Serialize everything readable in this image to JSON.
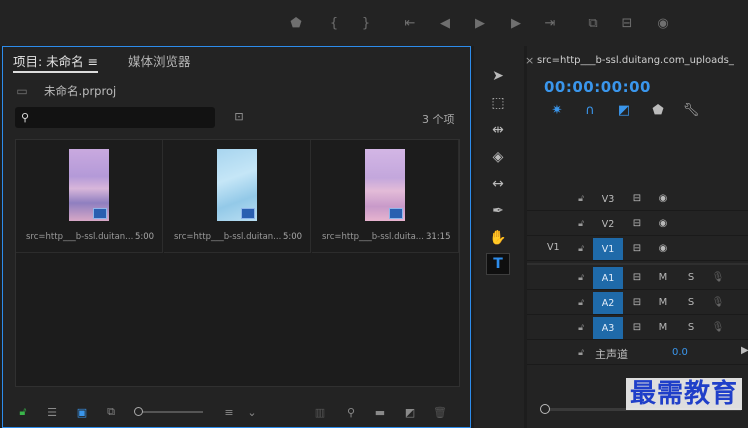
{
  "project": {
    "tab_active": "项目: 未命名",
    "tab_menu_glyph": "≡",
    "tab_inactive": "媒体浏览器",
    "file": "未命名.prproj",
    "item_count": "3 个项",
    "clips": [
      {
        "name": "src=http___b-ssl.duitan...",
        "duration": "5:00"
      },
      {
        "name": "src=http___b-ssl.duitan...",
        "duration": "5:00"
      },
      {
        "name": "src=http___b-ssl.duita...",
        "duration": "31:15"
      }
    ]
  },
  "timeline": {
    "tab": "src=http___b-ssl.duitang.com_uploads_",
    "tab_close": "×",
    "timecode": "00:00:00:00",
    "source_patch": "V1",
    "video_tracks": [
      "V3",
      "V2",
      "V1"
    ],
    "audio_tracks": [
      "A1",
      "A2",
      "A3"
    ],
    "mute": "M",
    "solo": "S",
    "master_label": "主声道",
    "master_value": "0.0"
  },
  "watermark": "最需教育",
  "colors": {
    "accent": "#2d8ceb",
    "track_target": "#1f6aa9",
    "timecode": "#3a96ec"
  }
}
